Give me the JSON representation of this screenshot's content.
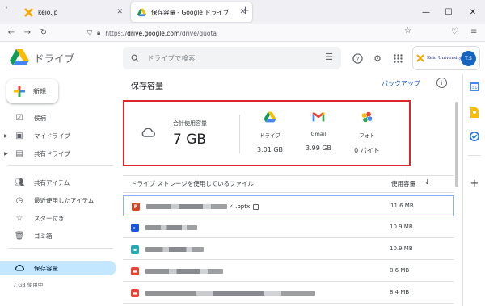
{
  "browser": {
    "tabs": [
      {
        "title": "keio.jp",
        "active": false
      },
      {
        "title": "保存容量 - Google ドライブ",
        "active": true
      }
    ],
    "new_tab": "+",
    "url_prefix": "https://",
    "url_host": "drive.google.com",
    "url_path": "/drive/quota"
  },
  "header": {
    "app_name": "ドライブ",
    "search_placeholder": "ドライブで検索",
    "org_label": "Keio University",
    "avatar_initials": "T.S"
  },
  "sidebar": {
    "new_label": "新規",
    "items": [
      {
        "label": "候補",
        "icon": "check-circle-icon"
      },
      {
        "label": "マイドライブ",
        "icon": "my-drive-icon",
        "expandable": true
      },
      {
        "label": "共有ドライブ",
        "icon": "shared-drives-icon",
        "expandable": true
      },
      {
        "label": "共有アイテム",
        "icon": "people-icon"
      },
      {
        "label": "最近使用したアイテム",
        "icon": "clock-icon"
      },
      {
        "label": "スター付き",
        "icon": "star-icon"
      },
      {
        "label": "ゴミ箱",
        "icon": "trash-icon"
      },
      {
        "label": "保存容量",
        "icon": "cloud-icon",
        "active": true
      }
    ],
    "usage_text": "7 GB 使用中"
  },
  "main": {
    "title": "保存容量",
    "backup_label": "バックアップ",
    "quota": {
      "total_label": "合計使用容量",
      "total_value": "7 GB",
      "services": [
        {
          "name": "ドライブ",
          "size": "3.01 GB",
          "icon": "google-drive-icon"
        },
        {
          "name": "Gmail",
          "size": "3.99 GB",
          "icon": "gmail-icon"
        },
        {
          "name": "フォト",
          "size": "0 バイト",
          "icon": "google-photos-icon"
        }
      ]
    },
    "table": {
      "header": "ドライブ  ストレージを使用しているファイル",
      "size_header": "使用容量",
      "rows": [
        {
          "name_visible": "✓ .pptx",
          "size": "11.6 MB",
          "type": "ppt",
          "color": "#d24726"
        },
        {
          "name_visible": "",
          "size": "10.9 MB",
          "type": "video",
          "color": "#1a56db"
        },
        {
          "name_visible": "",
          "size": "10.9 MB",
          "type": "image",
          "color": "#27a9b5"
        },
        {
          "name_visible": "",
          "size": "8.6 MB",
          "type": "pdf",
          "color": "#ea4335"
        },
        {
          "name_visible": "",
          "size": "8.4 MB",
          "type": "pdf",
          "color": "#ea4335"
        }
      ]
    }
  },
  "colors": {
    "highlight_border": "#e0242c",
    "link": "#0b57d0",
    "active_nav": "#c2e7ff"
  }
}
